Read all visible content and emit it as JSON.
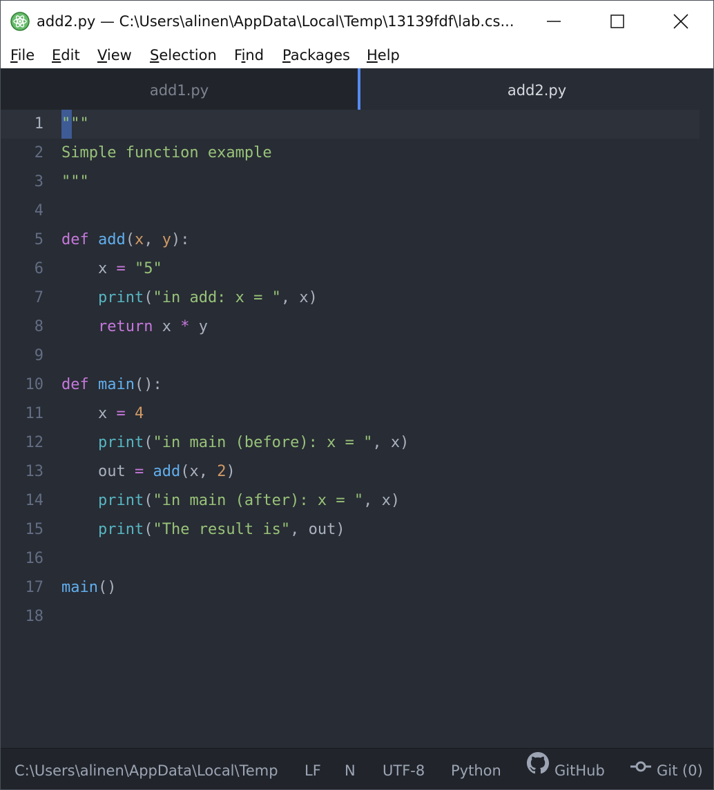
{
  "window": {
    "title": "add2.py — C:\\Users\\alinen\\AppData\\Local\\Temp\\13139fdf\\lab.cs..."
  },
  "menu": [
    {
      "acc": "F",
      "rest": "ile"
    },
    {
      "acc": "E",
      "rest": "dit"
    },
    {
      "acc": "V",
      "rest": "iew"
    },
    {
      "acc": "S",
      "rest": "election"
    },
    {
      "pre": "F",
      "acc": "i",
      "rest": "nd"
    },
    {
      "acc": "P",
      "rest": "ackages"
    },
    {
      "acc": "H",
      "rest": "elp"
    }
  ],
  "tabs": [
    {
      "label": "add1.py",
      "active": false
    },
    {
      "label": "add2.py",
      "active": true
    }
  ],
  "editor": {
    "active_line": 1,
    "lines": [
      {
        "n": "1",
        "tokens": [
          {
            "t": "\"\"\"",
            "c": "str"
          }
        ]
      },
      {
        "n": "2",
        "tokens": [
          {
            "t": "Simple function example",
            "c": "str"
          }
        ]
      },
      {
        "n": "3",
        "tokens": [
          {
            "t": "\"\"\"",
            "c": "str"
          }
        ]
      },
      {
        "n": "4",
        "tokens": []
      },
      {
        "n": "5",
        "tokens": [
          {
            "t": "def",
            "c": "kw"
          },
          {
            "t": " ",
            "c": "plain"
          },
          {
            "t": "add",
            "c": "fn"
          },
          {
            "t": "(",
            "c": "plain"
          },
          {
            "t": "x",
            "c": "param"
          },
          {
            "t": ", ",
            "c": "plain"
          },
          {
            "t": "y",
            "c": "param"
          },
          {
            "t": "):",
            "c": "plain"
          }
        ]
      },
      {
        "n": "6",
        "tokens": [
          {
            "t": "    x ",
            "c": "plain"
          },
          {
            "t": "=",
            "c": "op"
          },
          {
            "t": " ",
            "c": "plain"
          },
          {
            "t": "\"5\"",
            "c": "str"
          }
        ]
      },
      {
        "n": "7",
        "tokens": [
          {
            "t": "    ",
            "c": "plain"
          },
          {
            "t": "print",
            "c": "builtin"
          },
          {
            "t": "(",
            "c": "plain"
          },
          {
            "t": "\"in add: x = \"",
            "c": "str"
          },
          {
            "t": ", x)",
            "c": "plain"
          }
        ]
      },
      {
        "n": "8",
        "tokens": [
          {
            "t": "    ",
            "c": "plain"
          },
          {
            "t": "return",
            "c": "kw"
          },
          {
            "t": " x ",
            "c": "plain"
          },
          {
            "t": "*",
            "c": "op"
          },
          {
            "t": " y",
            "c": "plain"
          }
        ]
      },
      {
        "n": "9",
        "tokens": []
      },
      {
        "n": "10",
        "tokens": [
          {
            "t": "def",
            "c": "kw"
          },
          {
            "t": " ",
            "c": "plain"
          },
          {
            "t": "main",
            "c": "fn"
          },
          {
            "t": "():",
            "c": "plain"
          }
        ]
      },
      {
        "n": "11",
        "tokens": [
          {
            "t": "    x ",
            "c": "plain"
          },
          {
            "t": "=",
            "c": "op"
          },
          {
            "t": " ",
            "c": "plain"
          },
          {
            "t": "4",
            "c": "num"
          }
        ]
      },
      {
        "n": "12",
        "tokens": [
          {
            "t": "    ",
            "c": "plain"
          },
          {
            "t": "print",
            "c": "builtin"
          },
          {
            "t": "(",
            "c": "plain"
          },
          {
            "t": "\"in main (before): x = \"",
            "c": "str"
          },
          {
            "t": ", x)",
            "c": "plain"
          }
        ]
      },
      {
        "n": "13",
        "tokens": [
          {
            "t": "    out ",
            "c": "plain"
          },
          {
            "t": "=",
            "c": "op"
          },
          {
            "t": " ",
            "c": "plain"
          },
          {
            "t": "add",
            "c": "fn"
          },
          {
            "t": "(x, ",
            "c": "plain"
          },
          {
            "t": "2",
            "c": "num"
          },
          {
            "t": ")",
            "c": "plain"
          }
        ]
      },
      {
        "n": "14",
        "tokens": [
          {
            "t": "    ",
            "c": "plain"
          },
          {
            "t": "print",
            "c": "builtin"
          },
          {
            "t": "(",
            "c": "plain"
          },
          {
            "t": "\"in main (after): x = \"",
            "c": "str"
          },
          {
            "t": ", x)",
            "c": "plain"
          }
        ]
      },
      {
        "n": "15",
        "tokens": [
          {
            "t": "    ",
            "c": "plain"
          },
          {
            "t": "print",
            "c": "builtin"
          },
          {
            "t": "(",
            "c": "plain"
          },
          {
            "t": "\"The result is\"",
            "c": "str"
          },
          {
            "t": ", out)",
            "c": "plain"
          }
        ]
      },
      {
        "n": "16",
        "tokens": []
      },
      {
        "n": "17",
        "tokens": [
          {
            "t": "main",
            "c": "fn"
          },
          {
            "t": "()",
            "c": "plain"
          }
        ]
      },
      {
        "n": "18",
        "tokens": []
      }
    ]
  },
  "status": {
    "path": "C:\\Users\\alinen\\AppData\\Local\\Temp",
    "line_ending": "LF",
    "n_label": "N",
    "encoding": "UTF-8",
    "grammar": "Python",
    "github": "GitHub",
    "git": "Git (0)"
  },
  "colors": {
    "background": "#282c34",
    "tab_accent": "#568af2",
    "string": "#98c379",
    "keyword": "#c678dd",
    "function": "#61afef",
    "number": "#d19a66",
    "builtin": "#56b6c2"
  },
  "icons": {
    "app": "atom-icon",
    "minimize": "minimize-icon",
    "maximize": "maximize-icon",
    "close": "close-icon",
    "github": "github-icon",
    "git": "git-commit-icon"
  }
}
